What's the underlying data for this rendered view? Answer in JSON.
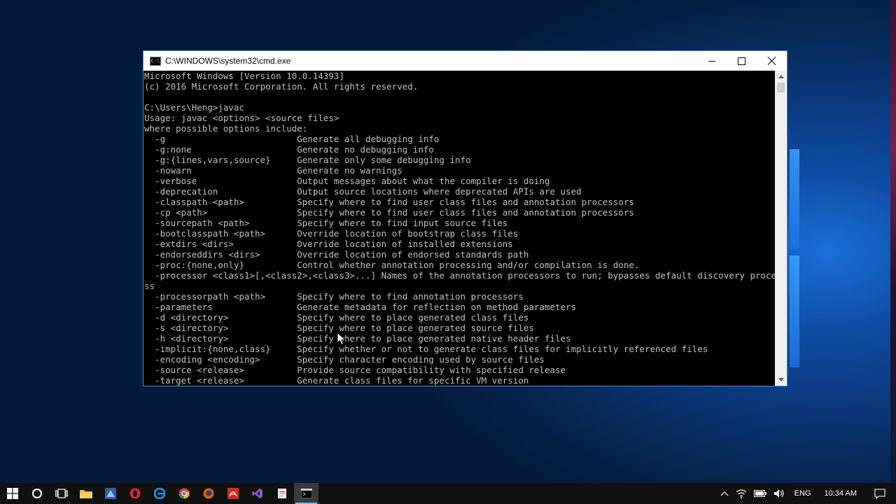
{
  "window": {
    "title": "C:\\WINDOWS\\system32\\cmd.exe",
    "icon_label": "C:\\"
  },
  "console": {
    "lines": [
      "Microsoft Windows [Version 10.0.14393]",
      "(c) 2016 Microsoft Corporation. All rights reserved.",
      "",
      "C:\\Users\\Heng>javac",
      "Usage: javac <options> <source files>",
      "where possible options include:",
      "  -g                         Generate all debugging info",
      "  -g:none                    Generate no debugging info",
      "  -g:{lines,vars,source}     Generate only some debugging info",
      "  -nowarn                    Generate no warnings",
      "  -verbose                   Output messages about what the compiler is doing",
      "  -deprecation               Output source locations where deprecated APIs are used",
      "  -classpath <path>          Specify where to find user class files and annotation processors",
      "  -cp <path>                 Specify where to find user class files and annotation processors",
      "  -sourcepath <path>         Specify where to find input source files",
      "  -bootclasspath <path>      Override location of bootstrap class files",
      "  -extdirs <dirs>            Override location of installed extensions",
      "  -endorseddirs <dirs>       Override location of endorsed standards path",
      "  -proc:{none,only}          Control whether annotation processing and/or compilation is done.",
      "  -processor <class1>[,<class2>,<class3>...] Names of the annotation processors to run; bypasses default discovery proce",
      "ss",
      "  -processorpath <path>      Specify where to find annotation processors",
      "  -parameters                Generate metadata for reflection on method parameters",
      "  -d <directory>             Specify where to place generated class files",
      "  -s <directory>             Specify where to place generated source files",
      "  -h <directory>             Specify where to place generated native header files",
      "  -implicit:{none,class}     Specify whether or not to generate class files for implicitly referenced files",
      "  -encoding <encoding>       Specify character encoding used by source files",
      "  -source <release>          Provide source compatibility with specified release",
      "  -target <release>          Generate class files for specific VM version"
    ]
  },
  "taskbar": {
    "apps": [
      {
        "name": "start",
        "icon": "windows-logo-icon"
      },
      {
        "name": "cortana",
        "icon": "cortana-circle-icon"
      },
      {
        "name": "task-view",
        "icon": "task-view-icon"
      },
      {
        "name": "file-explorer",
        "icon": "folder-icon"
      },
      {
        "name": "app-blue",
        "icon": "app-blue-icon"
      },
      {
        "name": "opera",
        "icon": "opera-icon"
      },
      {
        "name": "edge",
        "icon": "edge-icon"
      },
      {
        "name": "chrome",
        "icon": "chrome-icon"
      },
      {
        "name": "firefox",
        "icon": "firefox-icon"
      },
      {
        "name": "acrobat",
        "icon": "acrobat-icon"
      },
      {
        "name": "visual-studio",
        "icon": "visual-studio-icon"
      },
      {
        "name": "notepad-app",
        "icon": "notepad-icon"
      },
      {
        "name": "cmd",
        "icon": "cmd-icon",
        "active": true
      }
    ],
    "tray": {
      "language": "ENG",
      "time": "10:34 AM"
    }
  },
  "colors": {
    "console_bg": "#000000",
    "console_text": "#c0c0c0",
    "taskbar_bg": "#101010",
    "accent": "#76b9ed"
  }
}
